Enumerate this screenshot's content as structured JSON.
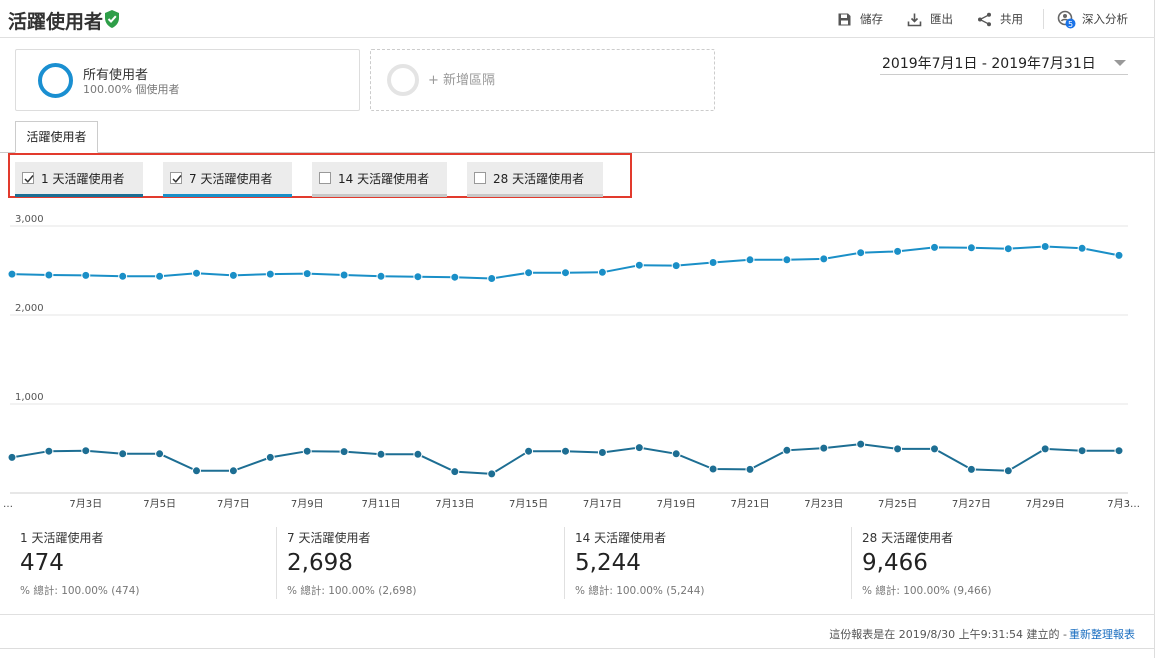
{
  "header": {
    "title": "活躍使用者",
    "save_label": "儲存",
    "export_label": "匯出",
    "share_label": "共用",
    "insights_label": "深入分析",
    "insights_badge": "5"
  },
  "segments": {
    "active": {
      "name": "所有使用者",
      "subtitle": "100.00% 個使用者"
    },
    "add_label": "+ 新增區隔"
  },
  "date_range": "2019年7月1日 - 2019年7月31日",
  "tab_label": "活躍使用者",
  "metrics": [
    {
      "label": "1 天活躍使用者",
      "checked": true,
      "color": "#1d6e93"
    },
    {
      "label": "7 天活躍使用者",
      "checked": true,
      "color": "#1a8fc7"
    },
    {
      "label": "14 天活躍使用者",
      "checked": false,
      "color": "#c8c8c8"
    },
    {
      "label": "28 天活躍使用者",
      "checked": false,
      "color": "#c8c8c8"
    }
  ],
  "chart_data": {
    "type": "line",
    "x": [
      "7月1日",
      "7月2日",
      "7月3日",
      "7月4日",
      "7月5日",
      "7月6日",
      "7月7日",
      "7月8日",
      "7月9日",
      "7月10日",
      "7月11日",
      "7月12日",
      "7月13日",
      "7月14日",
      "7月15日",
      "7月16日",
      "7月17日",
      "7月18日",
      "7月19日",
      "7月20日",
      "7月21日",
      "7月22日",
      "7月23日",
      "7月24日",
      "7月25日",
      "7月26日",
      "7月27日",
      "7月28日",
      "7月29日",
      "7月30日",
      "7月31日"
    ],
    "x_tick_labels": [
      "…",
      "7月3日",
      "7月5日",
      "7月7日",
      "7月9日",
      "7月11日",
      "7月13日",
      "7月15日",
      "7月17日",
      "7月19日",
      "7月21日",
      "7月23日",
      "7月25日",
      "7月27日",
      "7月29日",
      "7月3…"
    ],
    "y_tick_labels": [
      "3,000",
      "2,000",
      "1,000"
    ],
    "y_ticks": [
      3000,
      2000,
      1000
    ],
    "ylim": [
      0,
      3000
    ],
    "grid": true,
    "series": [
      {
        "name": "7 天活躍使用者",
        "color": "#1a8fc7",
        "values": [
          2460,
          2450,
          2445,
          2435,
          2435,
          2470,
          2445,
          2460,
          2465,
          2450,
          2435,
          2430,
          2425,
          2410,
          2475,
          2475,
          2480,
          2560,
          2555,
          2590,
          2620,
          2620,
          2630,
          2700,
          2715,
          2760,
          2755,
          2745,
          2770,
          2750,
          2670
        ]
      },
      {
        "name": "1 天活躍使用者",
        "color": "#1d6e93",
        "values": [
          400,
          470,
          475,
          440,
          440,
          250,
          250,
          400,
          470,
          465,
          435,
          435,
          240,
          215,
          470,
          470,
          455,
          510,
          440,
          270,
          265,
          480,
          505,
          550,
          495,
          495,
          265,
          250,
          495,
          475,
          475
        ]
      }
    ]
  },
  "summary": [
    {
      "label": "1 天活躍使用者",
      "value": "474",
      "total": "% 總計: 100.00% (474)"
    },
    {
      "label": "7 天活躍使用者",
      "value": "2,698",
      "total": "% 總計: 100.00% (2,698)"
    },
    {
      "label": "14 天活躍使用者",
      "value": "5,244",
      "total": "% 總計: 100.00% (5,244)"
    },
    {
      "label": "28 天活躍使用者",
      "value": "9,466",
      "total": "% 總計: 100.00% (9,466)"
    }
  ],
  "footer": {
    "text": "這份報表是在 2019/8/30 上午9:31:54 建立的 -",
    "refresh_label": "重新整理報表"
  }
}
